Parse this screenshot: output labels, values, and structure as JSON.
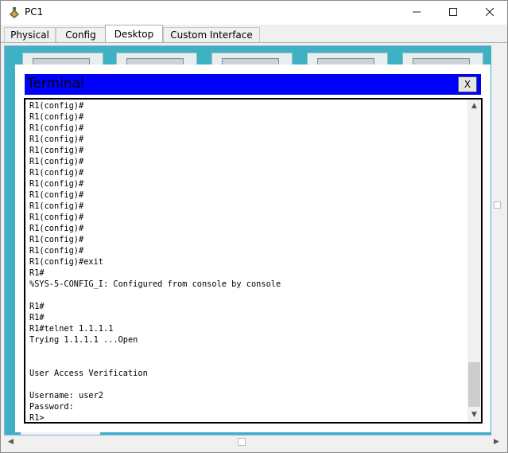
{
  "window": {
    "title": "PC1",
    "icon": "packet-tracer-pc-icon",
    "controls": [
      "minimize-icon",
      "maximize-icon",
      "close-icon"
    ]
  },
  "tabs": [
    {
      "label": "Physical",
      "active": false
    },
    {
      "label": "Config",
      "active": false
    },
    {
      "label": "Desktop",
      "active": true
    },
    {
      "label": "Custom Interface",
      "active": false
    }
  ],
  "terminal": {
    "title": "Terminal",
    "close_label": "X",
    "lines": [
      "R1(config)#",
      "R1(config)#",
      "R1(config)#",
      "R1(config)#",
      "R1(config)#",
      "R1(config)#",
      "R1(config)#",
      "R1(config)#",
      "R1(config)#",
      "R1(config)#",
      "R1(config)#",
      "R1(config)#",
      "R1(config)#",
      "R1(config)#",
      "R1(config)#exit",
      "R1#",
      "%SYS-5-CONFIG_I: Configured from console by console",
      "",
      "R1#",
      "R1#",
      "R1#telnet 1.1.1.1",
      "Trying 1.1.1.1 ...Open",
      "",
      "",
      "User Access Verification",
      "",
      "Username: user2",
      "Password: ",
      "R1>"
    ]
  },
  "colors": {
    "desktop_bg": "#3fb1c4",
    "terminal_titlebar": "#0000ff"
  }
}
